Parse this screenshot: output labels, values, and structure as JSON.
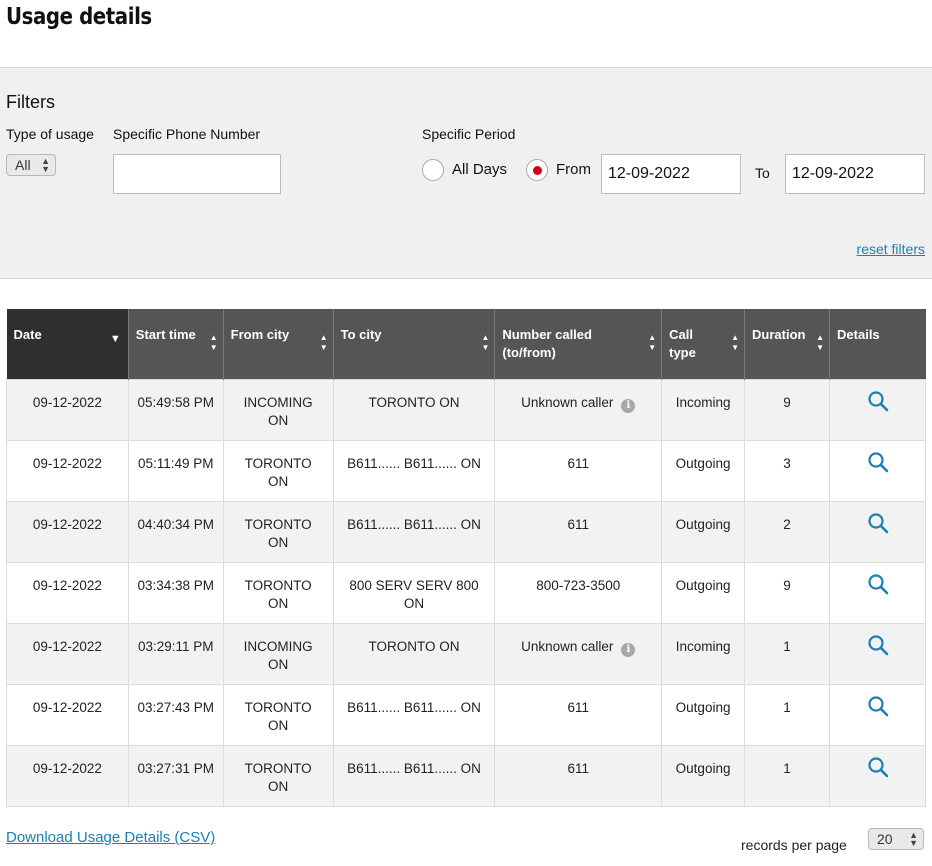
{
  "page": {
    "title": "Usage details"
  },
  "filters": {
    "heading": "Filters",
    "type_label": "Type of usage",
    "type_value": "All",
    "phone_label": "Specific Phone Number",
    "phone_value": "",
    "period_label": "Specific Period",
    "all_days_label": "All Days",
    "from_label": "From",
    "from_value": "12-09-2022",
    "to_label": "To",
    "to_value": "12-09-2022",
    "selected_period": "From",
    "reset_label": "reset filters"
  },
  "table": {
    "columns": [
      {
        "label": "Date",
        "sort": "desc"
      },
      {
        "label": "Start time",
        "sort": "both"
      },
      {
        "label": "From city",
        "sort": "both"
      },
      {
        "label": "To city",
        "sort": "both"
      },
      {
        "label": "Number called (to/from)",
        "sort": "both"
      },
      {
        "label": "Call type",
        "sort": "both"
      },
      {
        "label": "Duration",
        "sort": "both"
      },
      {
        "label": "Details",
        "sort": "none"
      }
    ],
    "rows": [
      {
        "date": "09-12-2022",
        "start": "05:49:58 PM",
        "from_city": "INCOMING ON",
        "to_city": "TORONTO ON",
        "number": "Unknown caller",
        "info": true,
        "type": "Incoming",
        "duration": "9"
      },
      {
        "date": "09-12-2022",
        "start": "05:11:49 PM",
        "from_city": "TORONTO ON",
        "to_city": "B611...... B611...... ON",
        "number": "611",
        "info": false,
        "type": "Outgoing",
        "duration": "3"
      },
      {
        "date": "09-12-2022",
        "start": "04:40:34 PM",
        "from_city": "TORONTO ON",
        "to_city": "B611...... B611...... ON",
        "number": "611",
        "info": false,
        "type": "Outgoing",
        "duration": "2"
      },
      {
        "date": "09-12-2022",
        "start": "03:34:38 PM",
        "from_city": "TORONTO ON",
        "to_city": "800 SERV SERV 800 ON",
        "number": "800-723-3500",
        "info": false,
        "type": "Outgoing",
        "duration": "9"
      },
      {
        "date": "09-12-2022",
        "start": "03:29:11 PM",
        "from_city": "INCOMING ON",
        "to_city": "TORONTO ON",
        "number": "Unknown caller",
        "info": true,
        "type": "Incoming",
        "duration": "1"
      },
      {
        "date": "09-12-2022",
        "start": "03:27:43 PM",
        "from_city": "TORONTO ON",
        "to_city": "B611...... B611...... ON",
        "number": "611",
        "info": false,
        "type": "Outgoing",
        "duration": "1"
      },
      {
        "date": "09-12-2022",
        "start": "03:27:31 PM",
        "from_city": "TORONTO ON",
        "to_city": "B611...... B611...... ON",
        "number": "611",
        "info": false,
        "type": "Outgoing",
        "duration": "1"
      }
    ],
    "details_icon": "magnifier-icon",
    "info_icon": "info-icon"
  },
  "footer": {
    "csv_label": "Download Usage Details (CSV)",
    "per_page_label": "records per page",
    "per_page_value": "20"
  },
  "colors": {
    "accent_link": "#1a7fb5",
    "header_bg": "#555555",
    "header_active_bg": "#2f2f2f",
    "radio_selected": "#d0021b"
  }
}
